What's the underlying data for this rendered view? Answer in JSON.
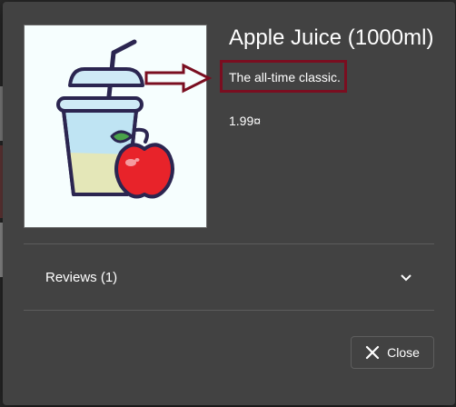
{
  "product": {
    "name": "Apple Juice (1000ml)",
    "description": "The all-time classic.",
    "price": "1.99¤",
    "image_icon": "apple-juice-image"
  },
  "reviews": {
    "label": "Reviews (1)",
    "icon": "chevron-down-icon"
  },
  "actions": {
    "close_label": "Close",
    "close_icon": "close-icon"
  },
  "colors": {
    "dialog_background": "#424242",
    "highlight": "#7a0e20",
    "image_background": "#f6fefe"
  }
}
